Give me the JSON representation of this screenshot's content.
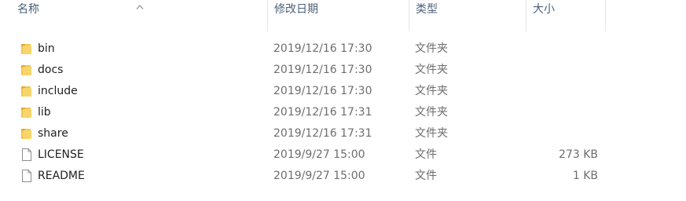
{
  "columns": {
    "name": "名称",
    "date": "修改日期",
    "type": "类型",
    "size": "大小"
  },
  "sort": {
    "column": "name",
    "direction": "ascending",
    "icon": "sort-up-icon"
  },
  "colors": {
    "header_text": "#4c607a",
    "folder_icon": "#f4c64e",
    "secondary_text": "#6d6d6d"
  },
  "files": [
    {
      "name": "bin",
      "date": "2019/12/16 17:30",
      "type": "文件夹",
      "size": "",
      "icon": "folder-icon"
    },
    {
      "name": "docs",
      "date": "2019/12/16 17:30",
      "type": "文件夹",
      "size": "",
      "icon": "folder-icon"
    },
    {
      "name": "include",
      "date": "2019/12/16 17:30",
      "type": "文件夹",
      "size": "",
      "icon": "folder-icon"
    },
    {
      "name": "lib",
      "date": "2019/12/16 17:31",
      "type": "文件夹",
      "size": "",
      "icon": "folder-icon"
    },
    {
      "name": "share",
      "date": "2019/12/16 17:31",
      "type": "文件夹",
      "size": "",
      "icon": "folder-icon"
    },
    {
      "name": "LICENSE",
      "date": "2019/9/27 15:00",
      "type": "文件",
      "size": "273 KB",
      "icon": "file-icon"
    },
    {
      "name": "README",
      "date": "2019/9/27 15:00",
      "type": "文件",
      "size": "1 KB",
      "icon": "file-icon"
    }
  ]
}
